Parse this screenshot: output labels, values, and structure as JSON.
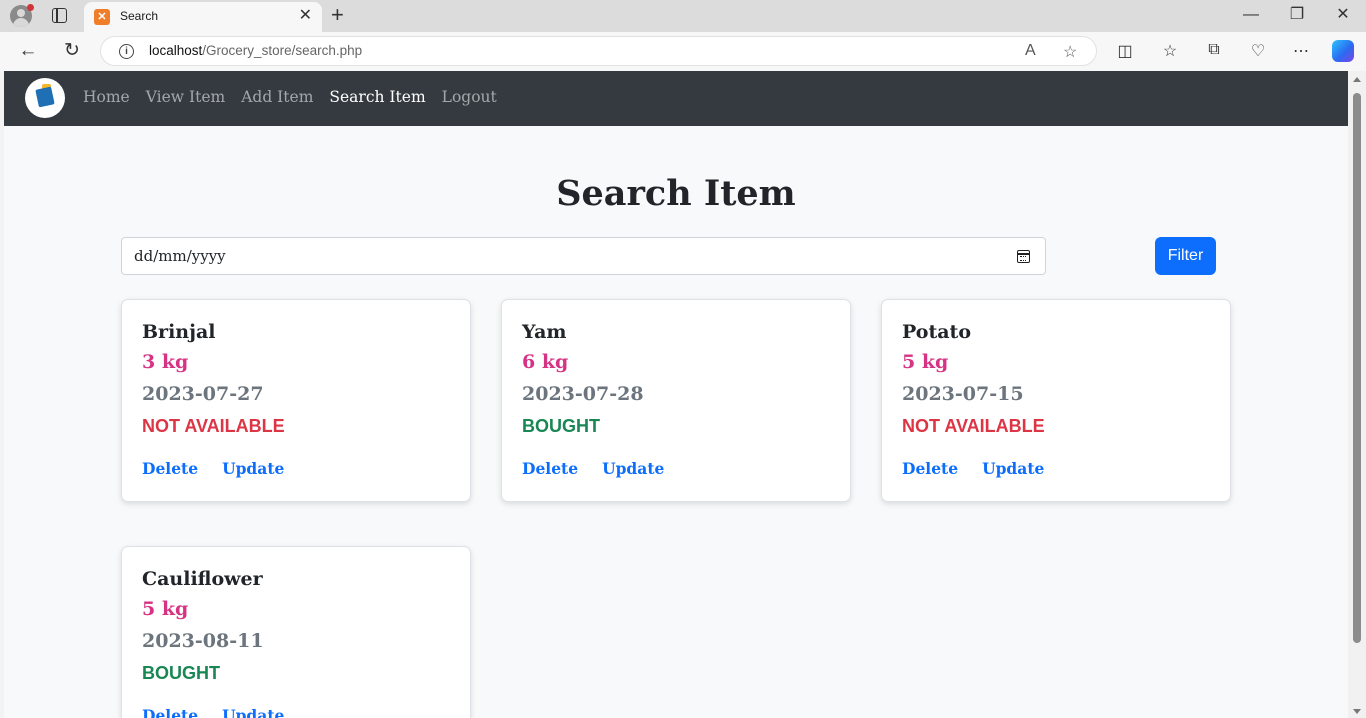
{
  "browser": {
    "tab_title": "Search",
    "tab_icon": "xampp-icon",
    "url_host": "localhost",
    "url_path": "/Grocery_store/search.php"
  },
  "navbar": {
    "links": [
      {
        "label": "Home",
        "active": false
      },
      {
        "label": "View Item",
        "active": false
      },
      {
        "label": "Add Item",
        "active": false
      },
      {
        "label": "Search Item",
        "active": true
      },
      {
        "label": "Logout",
        "active": false
      }
    ]
  },
  "page": {
    "title": "Search Item"
  },
  "search": {
    "date_placeholder": "dd/mm/yyyy",
    "filter_label": "Filter"
  },
  "items": [
    {
      "name": "Brinjal",
      "quantity": "3 kg",
      "date": "2023-07-27",
      "status": "NOT AVAILABLE",
      "status_type": "na",
      "delete_label": "Delete",
      "update_label": "Update"
    },
    {
      "name": "Yam",
      "quantity": "6 kg",
      "date": "2023-07-28",
      "status": "BOUGHT",
      "status_type": "bought",
      "delete_label": "Delete",
      "update_label": "Update"
    },
    {
      "name": "Potato",
      "quantity": "5 kg",
      "date": "2023-07-15",
      "status": "NOT AVAILABLE",
      "status_type": "na",
      "delete_label": "Delete",
      "update_label": "Update"
    },
    {
      "name": "Cauliflower",
      "quantity": "5 kg",
      "date": "2023-08-11",
      "status": "BOUGHT",
      "status_type": "bought",
      "delete_label": "Delete",
      "update_label": "Update"
    }
  ],
  "colors": {
    "navbar_bg": "#343a40",
    "quantity": "#d63384",
    "not_available": "#dc3545",
    "bought": "#198754",
    "link": "#0d6efd",
    "filter_button": "#0d6efd"
  }
}
